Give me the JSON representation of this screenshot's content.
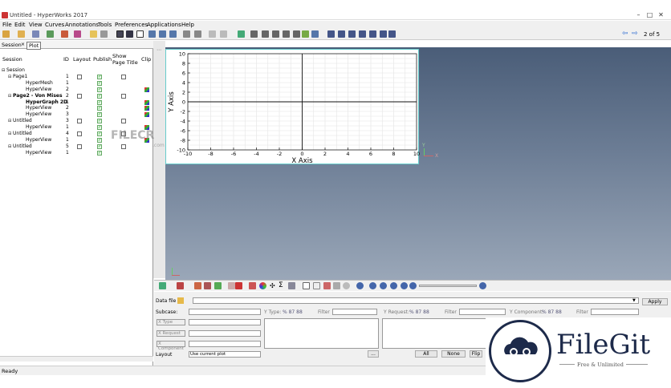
{
  "window": {
    "title": "Untitled - HyperWorks 2017",
    "page_indicator": "2 of 5"
  },
  "menu": [
    "File",
    "Edit",
    "View",
    "Curves",
    "Annotations",
    "Tools",
    "Preferences",
    "Applications",
    "Help"
  ],
  "session_tabs": {
    "tab1": "Session",
    "tab2": "Plot"
  },
  "session_table": {
    "headers": {
      "session": "Session",
      "id": "ID",
      "layout": "Layout",
      "publish": "Publish",
      "show_page_title": "Show Page Title",
      "clip": "Clip"
    },
    "rows": [
      {
        "label": "Session",
        "id": "",
        "indent": 0,
        "bold": false,
        "layout": false,
        "publish": false,
        "title": false,
        "color": false
      },
      {
        "label": "Page1",
        "id": "1",
        "indent": 1,
        "bold": false,
        "layout": true,
        "publish": true,
        "title": true,
        "color": false
      },
      {
        "label": "HyperMesh",
        "id": "1",
        "indent": 2,
        "bold": false,
        "layout": false,
        "publish": true,
        "title": false,
        "color": false
      },
      {
        "label": "HyperView",
        "id": "2",
        "indent": 2,
        "bold": false,
        "layout": false,
        "publish": true,
        "title": false,
        "color": true
      },
      {
        "label": "Page2 - Von Mises",
        "id": "2",
        "indent": 1,
        "bold": true,
        "layout": true,
        "publish": true,
        "title": true,
        "color": false
      },
      {
        "label": "HyperGraph 2D",
        "id": "1",
        "indent": 2,
        "bold": true,
        "layout": false,
        "publish": true,
        "title": false,
        "color": true
      },
      {
        "label": "HyperView",
        "id": "2",
        "indent": 2,
        "bold": false,
        "layout": false,
        "publish": true,
        "title": false,
        "color": true
      },
      {
        "label": "HyperView",
        "id": "3",
        "indent": 2,
        "bold": false,
        "layout": false,
        "publish": true,
        "title": false,
        "color": true
      },
      {
        "label": "Untitled",
        "id": "3",
        "indent": 1,
        "bold": false,
        "layout": true,
        "publish": true,
        "title": true,
        "color": false
      },
      {
        "label": "HyperView",
        "id": "1",
        "indent": 2,
        "bold": false,
        "layout": false,
        "publish": true,
        "title": false,
        "color": true
      },
      {
        "label": "Untitled",
        "id": "4",
        "indent": 1,
        "bold": false,
        "layout": true,
        "publish": true,
        "title": true,
        "color": false
      },
      {
        "label": "HyperView",
        "id": "1",
        "indent": 2,
        "bold": false,
        "layout": false,
        "publish": true,
        "title": false,
        "color": true
      },
      {
        "label": "Untitled",
        "id": "5",
        "indent": 1,
        "bold": false,
        "layout": true,
        "publish": true,
        "title": true,
        "color": false
      },
      {
        "label": "HyperView",
        "id": "1",
        "indent": 2,
        "bold": false,
        "layout": false,
        "publish": true,
        "title": false,
        "color": false
      }
    ]
  },
  "chart_data": {
    "type": "line",
    "xlabel": "X Axis",
    "ylabel": "Y Axis",
    "xlim": [
      -10,
      10
    ],
    "ylim": [
      -10,
      10
    ],
    "xticks": [
      -10,
      -8,
      -6,
      -4,
      -2,
      0,
      2,
      4,
      6,
      8,
      10
    ],
    "yticks": [
      -10,
      -8,
      -6,
      -4,
      -2,
      0,
      2,
      4,
      6,
      8,
      10
    ],
    "grid": true,
    "series": []
  },
  "triad": {
    "x": "X",
    "y": "Y"
  },
  "panel": {
    "data_file_label": "Data file",
    "apply": "Apply",
    "subcase_label": "Subcase:",
    "xtype_label": "X Type",
    "xrequest_label": "X Request",
    "xcomponent_label": "X Component",
    "ytype_label": "Y Type:",
    "ytype_sel": "% 87 88",
    "filter_label": "Filter",
    "yrequest_label": "Y Request:",
    "yrequest_sel": "% 87 88",
    "ycomponent_label": "Y Component:",
    "ycomponent_sel": "% 87 88",
    "layout_label": "Layout",
    "layout_value": "Use current plot",
    "btn_all": "All",
    "btn_none": "None",
    "btn_flip": "Flip",
    "more": "..."
  },
  "status": "Ready",
  "watermark": {
    "filecr": "FILECR",
    ".com": ".com",
    "title": "FileGit",
    "subtitle": "Free & Unlimited"
  }
}
